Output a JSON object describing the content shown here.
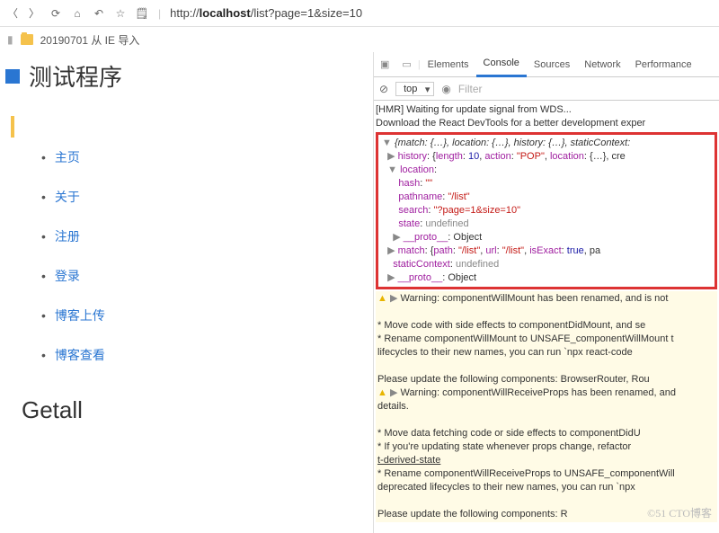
{
  "topbar": {
    "url_pre": "http://",
    "url_host": "localhost",
    "url_path": "/list?page=1&size=10"
  },
  "favorites": {
    "folder": "20190701 从 IE 导入"
  },
  "app": {
    "title": "测试程序",
    "nav": [
      "主页",
      "关于",
      "注册",
      "登录",
      "博客上传",
      "博客查看"
    ],
    "section": "Getall"
  },
  "dev": {
    "tabs": [
      "Elements",
      "Console",
      "Sources",
      "Network",
      "Performance"
    ],
    "active": "Console",
    "context": "top",
    "filter": "Filter",
    "hmr": "[HMR] Waiting for update signal from WDS...",
    "dl": "Download the React DevTools for a better development exper",
    "obj_summary": "{match: {…}, location: {…}, history: {…}, staticContext:",
    "history": {
      "length": 10,
      "action": "\"POP\"",
      "loc": "{…}"
    },
    "location": {
      "hash": "\"\"",
      "pathname": "\"/list\"",
      "search": "\"?page=1&size=10\"",
      "state": "undefined"
    },
    "proto": "__proto__",
    "object": "Object",
    "match": {
      "path": "\"/list\"",
      "url": "\"/list\"",
      "isExact": "true"
    },
    "staticContext": "undefined",
    "w1": "Warning: componentWillMount has been renamed, and is not",
    "w1b1": "* Move code with side effects to componentDidMount, and se",
    "w1b2": "* Rename componentWillMount to UNSAFE_componentWillMount t",
    "w1b3": "lifecycles to their new names, you can run `npx react-code",
    "w1u": "Please update the following components: BrowserRouter, Rou",
    "w2": "Warning: componentWillReceiveProps has been renamed, and",
    "w2d": "details.",
    "w2b1": "* Move data fetching code or side effects to componentDidU",
    "w2b2": "* If you're updating state whenever props change, refactor",
    "w2l": "t-derived-state",
    "w2b3": "* Rename componentWillReceiveProps to UNSAFE_componentWill",
    "w2b4": "deprecated lifecycles to their new names, you can run `npx",
    "w2u": "Please update the following components: R"
  },
  "watermark": "©51 CTO博客"
}
